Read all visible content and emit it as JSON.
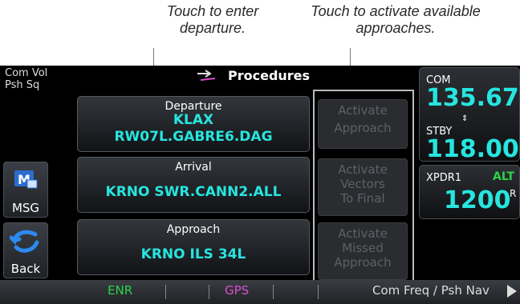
{
  "callouts": {
    "departure": "Touch to enter departure.",
    "activate": "Touch to activate available approaches."
  },
  "left": {
    "com_vol": [
      "Com Vol",
      "Psh Sq"
    ],
    "msg_label": "MSG",
    "back_label": "Back"
  },
  "header": {
    "title": "Procedures"
  },
  "procedures": {
    "departure": {
      "heading": "Departure",
      "airport": "KLAX",
      "procedure": "RW07L.GABRE6.DAG"
    },
    "arrival": {
      "heading": "Arrival",
      "procedure": "KRNO SWR.CANN2.ALL"
    },
    "approach": {
      "heading": "Approach",
      "procedure": "KRNO ILS 34L"
    }
  },
  "activate": {
    "approach": [
      "Activate",
      "Approach"
    ],
    "vectors": [
      "Activate",
      "Vectors",
      "To Final"
    ],
    "missed": [
      "Activate",
      "Missed",
      "Approach"
    ]
  },
  "radio": {
    "com_label": "COM",
    "com_active": "135.67",
    "stby_label": "STBY",
    "com_standby": "118.00",
    "xpdr_label": "XPDR1",
    "xpdr_mode": "ALT",
    "xpdr_code": "1200",
    "xpdr_reply": "R"
  },
  "bottom": {
    "enr": "ENR",
    "gps": "GPS",
    "right": "Com Freq / Psh Nav"
  },
  "colors": {
    "cyan": "#27e5df",
    "enr": "#2bd44a",
    "gps": "#d64fd0",
    "alt": "#2bd44a"
  }
}
